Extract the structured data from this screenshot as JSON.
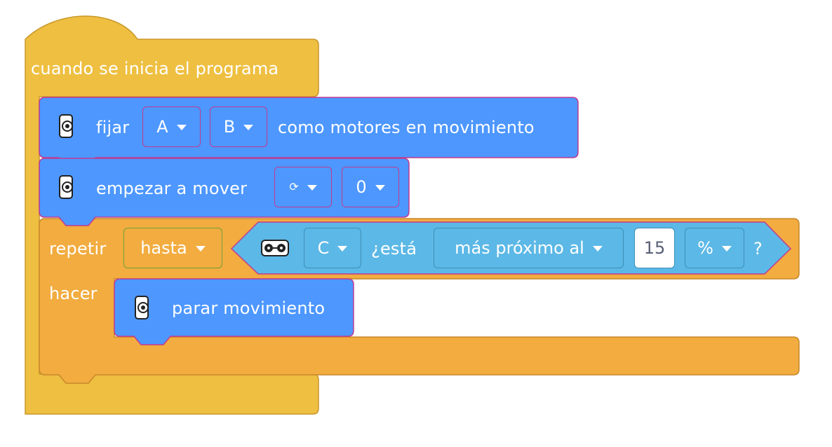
{
  "colors": {
    "events": "#eebf41",
    "control": "#f2ac3f",
    "motion": "#4d97ff",
    "sensing": "#5cb8e6"
  },
  "hat_block": {
    "label": "cuando se inicia el programa"
  },
  "set_motors_block": {
    "icon": "hub-icon",
    "label_prefix": "fijar",
    "port_left": "A",
    "port_right": "B",
    "label_suffix": "como motores en movimiento"
  },
  "start_moving_block": {
    "icon": "hub-icon",
    "label": "empezar a mover",
    "direction": "⟳",
    "steering": "0"
  },
  "repeat_block": {
    "label": "repetir",
    "mode": "hasta",
    "do_label": "hacer"
  },
  "distance_condition": {
    "icon": "distance-sensor-icon",
    "port": "C",
    "label": "¿está",
    "comparison": "más próximo al",
    "value": "15",
    "unit": "%",
    "question_mark": "?"
  },
  "stop_block": {
    "icon": "hub-icon",
    "label": "parar movimiento"
  }
}
